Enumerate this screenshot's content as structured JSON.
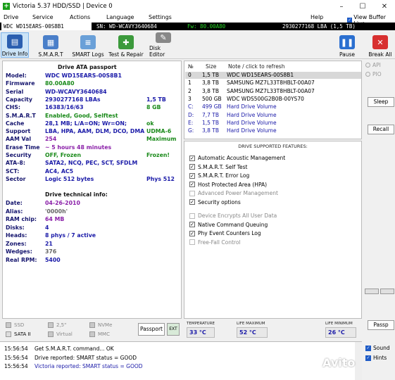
{
  "window": {
    "title": "Victoria 5.37 HDD/SSD | Device 0",
    "controls": {
      "minimize": "–",
      "maximize": "☐",
      "close": "✕"
    }
  },
  "menu": {
    "items": [
      "Drive",
      "Service",
      "Actions",
      "Language",
      "Settings",
      "Help"
    ],
    "view_buffer_live": "View Buffer Live"
  },
  "device_bar": {
    "model": "WDC WD15EARS-00S8B1",
    "sn": "SN: WD-WCAVY3640684",
    "fw": "Fw: 80.00A80",
    "lba": "2930277168 LBA (1,5 TB)"
  },
  "toolbar": {
    "drive_info": "Drive Info",
    "smart": "S.M.A.R.T",
    "smart_logs": "SMART Logs",
    "test_repair": "Test & Repair",
    "disk_editor": "Disk Editor",
    "pause": "Pause",
    "break_all": "Break All"
  },
  "passport": {
    "title": "Drive ATA passport",
    "rows": [
      {
        "k": "Model:",
        "v": "WDC WD15EARS-00S8B1",
        "v2": "",
        "cls": ""
      },
      {
        "k": "Firmware",
        "v": "80.00A80",
        "v2": "",
        "cls": "c-green"
      },
      {
        "k": "Serial",
        "v": "WD-WCAVY3640684",
        "v2": "",
        "cls": ""
      },
      {
        "k": "Capacity",
        "v": "2930277168 LBAs",
        "v2": "1,5 TB",
        "cls": ""
      },
      {
        "k": "CHS:",
        "v": "16383/16/63",
        "v2": "8 GB",
        "cls": ""
      },
      {
        "k": "S.M.A.R.T",
        "v": "Enabled, Good, Selftest",
        "v2": "",
        "cls": "c-green"
      },
      {
        "k": "Cache",
        "v": "28,1 MB; L/A=ON; Wr=ON;",
        "v2": "ok",
        "cls": ""
      },
      {
        "k": "Support",
        "v": "LBA, HPA, AAM, DLM, DCO, DMA",
        "v2": "UDMA-6",
        "cls": ""
      },
      {
        "k": "AAM Val",
        "v": "254",
        "v2": "Maximum",
        "cls": "c-purple"
      },
      {
        "k": "Erase Time",
        "v": "~ 5 hours 48 minutes",
        "v2": "",
        "cls": "c-purple"
      },
      {
        "k": "Security",
        "v": "OFF, Frozen",
        "v2": "Frozen!",
        "cls": "c-green"
      },
      {
        "k": "ATA-8:",
        "v": "SATA2, NCQ, PEC, SCT, SFDLM",
        "v2": "",
        "cls": ""
      },
      {
        "k": "SCT:",
        "v": "AC4, AC5",
        "v2": "",
        "cls": ""
      },
      {
        "k": "Sector",
        "v": "Logic 512 bytes",
        "v2": "Phys 512",
        "cls": ""
      }
    ],
    "tech_title": "Drive technical info:",
    "tech_rows": [
      {
        "k": "Date:",
        "v": "04-26-2010",
        "cls": "c-purple"
      },
      {
        "k": "Alias:",
        "v": "'0000h'",
        "cls": "c-grey"
      },
      {
        "k": "RAM chip:",
        "v": "64 MB",
        "cls": "c-purple"
      },
      {
        "k": "Disks:",
        "v": "4",
        "cls": ""
      },
      {
        "k": "Heads:",
        "v": "8 phys / 7 active",
        "cls": ""
      },
      {
        "k": "Zones:",
        "v": "21",
        "cls": ""
      },
      {
        "k": "Wedges:",
        "v": "376",
        "cls": "c-grey"
      },
      {
        "k": "Real RPM:",
        "v": "5400",
        "cls": ""
      }
    ]
  },
  "drives": {
    "headers": {
      "num": "№",
      "size": "Size",
      "note": "Note / click to refresh"
    },
    "rows": [
      {
        "n": "0",
        "size": "1,5 TB",
        "note": "WDC WD15EARS-00S8B1",
        "sel": true,
        "vol": false
      },
      {
        "n": "1",
        "size": "3,8 TB",
        "note": "SAMSUNG MZ7L33T8HBLT-00A07",
        "sel": false,
        "vol": false
      },
      {
        "n": "2",
        "size": "3,8 TB",
        "note": "SAMSUNG MZ7L33T8HBLT-00A07",
        "sel": false,
        "vol": false
      },
      {
        "n": "3",
        "size": "500 GB",
        "note": "WDC WDS500G2B0B-00YS70",
        "sel": false,
        "vol": false
      },
      {
        "n": "C:",
        "size": "499 GB",
        "note": "Hard Drive Volume",
        "sel": false,
        "vol": true
      },
      {
        "n": "D:",
        "size": "7,7 TB",
        "note": "Hard Drive Volume",
        "sel": false,
        "vol": true
      },
      {
        "n": "E:",
        "size": "1,5 TB",
        "note": "Hard Drive Volume",
        "sel": false,
        "vol": true
      },
      {
        "n": "G:",
        "size": "3,8 TB",
        "note": "Hard Drive Volume",
        "sel": false,
        "vol": true
      }
    ]
  },
  "features": {
    "title": "DRIVE SUPPORTED FEATURES:",
    "items": [
      {
        "label": "Automatic Acoustic Management",
        "on": true
      },
      {
        "label": "S.M.A.R.T. Self Test",
        "on": true
      },
      {
        "label": "S.M.A.R.T. Error Log",
        "on": true
      },
      {
        "label": "Host Protected Area (HPA)",
        "on": true
      },
      {
        "label": "Advanced Power Management",
        "on": false
      },
      {
        "label": "Security options",
        "on": true
      },
      {
        "label": "Device Encrypts All User Data",
        "on": false
      },
      {
        "label": "Native Command Queuing",
        "on": true
      },
      {
        "label": "Phy Event Counters Log",
        "on": true
      },
      {
        "label": "Free-Fall Control",
        "on": false
      }
    ]
  },
  "right": {
    "api": "API",
    "pio": "PIO",
    "sleep": "Sleep",
    "recall": "Recall",
    "passp": "Passp"
  },
  "interfaces": {
    "ssd": "SSD",
    "sata": "SATA II",
    "size25": "2,5\"",
    "virtual": "Virtual",
    "nvme": "NVMe",
    "mmc": "MMC"
  },
  "bottom": {
    "passport": "Passport",
    "ext": "EXT",
    "temperature_label": "TEMPERATURE",
    "temperature": "33 °C",
    "life_max_label": "LIFE MAXIMUM",
    "life_max": "52 °C",
    "life_min_label": "LIFE MINIMUM",
    "life_min": "26 °C"
  },
  "log": [
    {
      "t": "15:56:54",
      "m": "Get S.M.A.R.T. command... OK",
      "blue": false
    },
    {
      "t": "15:56:54",
      "m": "Drive reported: SMART status = GOOD",
      "blue": false
    },
    {
      "t": "15:56:54",
      "m": "Victoria reported: SMART status = GOOD",
      "blue": true
    }
  ],
  "sound": "Sound",
  "hints": "Hints",
  "watermark": "Avito"
}
